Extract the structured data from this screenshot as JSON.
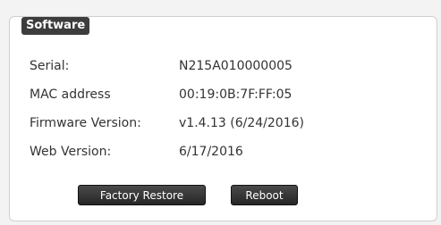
{
  "panel": {
    "title": "Software"
  },
  "info": {
    "rows": [
      {
        "label": "Serial:",
        "value": "N215A010000005"
      },
      {
        "label": "MAC address",
        "value": "00:19:0B:7F:FF:05"
      },
      {
        "label": "Firmware Version:",
        "value": "v1.4.13 (6/24/2016)"
      },
      {
        "label": "Web Version:",
        "value": "6/17/2016"
      }
    ]
  },
  "actions": {
    "factory_restore_label": "Factory Restore",
    "reboot_label": "Reboot"
  }
}
